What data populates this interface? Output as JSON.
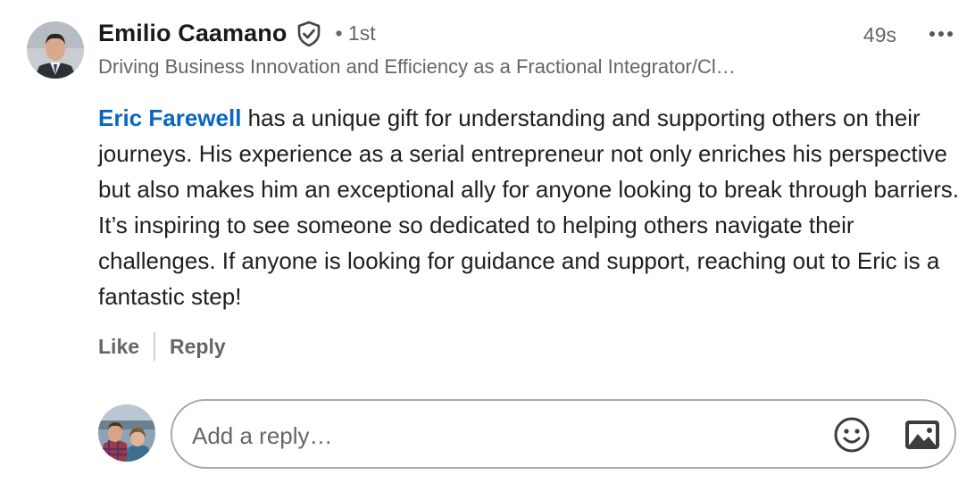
{
  "comment": {
    "author": {
      "name": "Emilio Caamano",
      "degree": "• 1st",
      "headline": "Driving Business Innovation and Efficiency as a Fractional Integrator/Cl…"
    },
    "timestamp": "49s",
    "mention": "Eric Farewell",
    "text": " has a unique gift for understanding and supporting others on their journeys. His experience as a serial entrepreneur not only enriches his perspective but also makes him an exceptional ally for anyone looking to break through barriers. It’s inspiring to see someone so dedicated to helping others navigate their challenges. If anyone is looking for guidance and support, reaching out to Eric is a fantastic step!",
    "actions": {
      "like_label": "Like",
      "reply_label": "Reply"
    }
  },
  "reply_box": {
    "placeholder": "Add a reply…",
    "value": ""
  },
  "icons": {
    "verified": "verified-shield-icon",
    "more": "more-options-icon",
    "emoji": "emoji-smile-icon",
    "photo": "photo-image-icon"
  },
  "colors": {
    "mention": "#0a66c2",
    "secondary_text": "#666666",
    "primary_text": "#1f1f1f",
    "border": "#a8a8a8"
  }
}
